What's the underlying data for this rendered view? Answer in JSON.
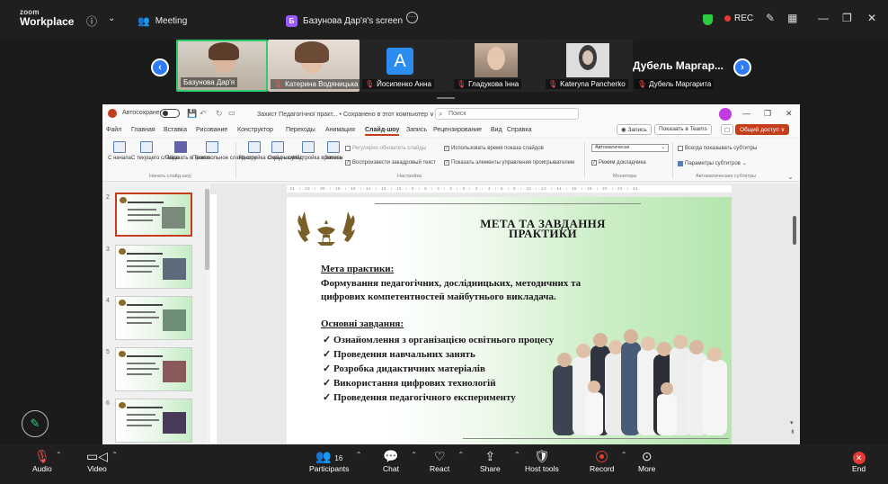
{
  "zoom": {
    "logo_top": "zoom",
    "logo_bottom": "Workplace",
    "meeting_label": "Meeting",
    "share_badge": "Б",
    "share_label": "Базунова Дар'я's screen",
    "rec_label": "REC"
  },
  "participants": [
    {
      "name": "Базунова Дар'я",
      "muted": false
    },
    {
      "name": "Катерина Водяницька",
      "muted": true
    },
    {
      "name": "Йосипенко Анна",
      "muted": true,
      "avatar": "A"
    },
    {
      "name": "Гладукова Інна",
      "muted": true
    },
    {
      "name": "Kateryna Pancherko",
      "muted": true
    },
    {
      "name": "Дубель Маргарита",
      "muted": true
    }
  ],
  "big_name": "Дубель Маргар...",
  "ppt": {
    "autosave": "Автосохранение",
    "doc_title": "Захист Педагогічної практ... • Сохранено в этот компьютер ∨",
    "search_placeholder": "Поиск",
    "menu": [
      "Файл",
      "Главная",
      "Вставка",
      "Рисование",
      "Конструктор",
      "Переходы",
      "Анимация",
      "Слайд-шоу",
      "Запись",
      "Рецензирование",
      "Вид",
      "Справка"
    ],
    "menu_selected": "Слайд-шоу",
    "btn_record": "Запись",
    "btn_teams": "Показать в Teams",
    "btn_share": "Общий доступ",
    "ribbon": {
      "b1": "С начала",
      "b2": "С текущего слайда",
      "b3": "Показать в Teams",
      "b4": "Произвольное слайд-шоу",
      "g1": "Начать слайд-шоу",
      "b5": "Настройка слайд-шоу",
      "b6": "Скрыть слайд",
      "b7": "Настройка времени",
      "b8": "Запись",
      "c1": "Регулярно обновлять слайды",
      "c2": "Воспроизвести закадровый текст",
      "c3": "Использовать время показа слайдов",
      "c4": "Показать элементы управления проигрывателем",
      "g2": "Настройка",
      "dd1": "Автоматически",
      "c5": "Режим докладчика",
      "g3": "Мониторы",
      "c6": "Всегда показывать субтитры",
      "c7": "Параметры субтитров",
      "g4": "Автоматические субтитры"
    },
    "ruler": "· 24 · ı · 22 · ı · 20 · ı · 18 · ı · 16 · ı · 14 · ı · 12 · ı · 10 · ı · 8 · ı · 6 · ı · 4 · ı · 2 · ı · 0 · ı · 2 · ı · 4 · ı · 6 · ı · 8 · ı · 10 · ı · 12 · ı · 14 · ı · 16 · ı · 18 · ı · 20 · ı · 22 · ı · 24 ·",
    "thumb_numbers": [
      "2",
      "3",
      "4",
      "5",
      "6"
    ]
  },
  "slide": {
    "title_line1": "МЕТА ТА ЗАВДАННЯ",
    "title_line2": "ПРАКТИКИ",
    "goal_heading": "Мета практики:",
    "goal_line1": "Формування педагогічних, дослідницьких, методичних та",
    "goal_line2": "цифрових компетентностей майбутнього викладача.",
    "tasks_heading": "Основні завдання:",
    "tasks": [
      "Ознайомлення з організацією освітнього процесу",
      "Проведення навчальних занять",
      "Розробка дидактичних матеріалів",
      "Використання цифрових технологій",
      "Проведення педагогічного експерименту"
    ]
  },
  "bottom": {
    "audio": "Audio",
    "video": "Video",
    "participants": "Participants",
    "participants_count": "16",
    "chat": "Chat",
    "react": "React",
    "share": "Share",
    "host_tools": "Host tools",
    "record": "Record",
    "more": "More",
    "end": "End"
  }
}
